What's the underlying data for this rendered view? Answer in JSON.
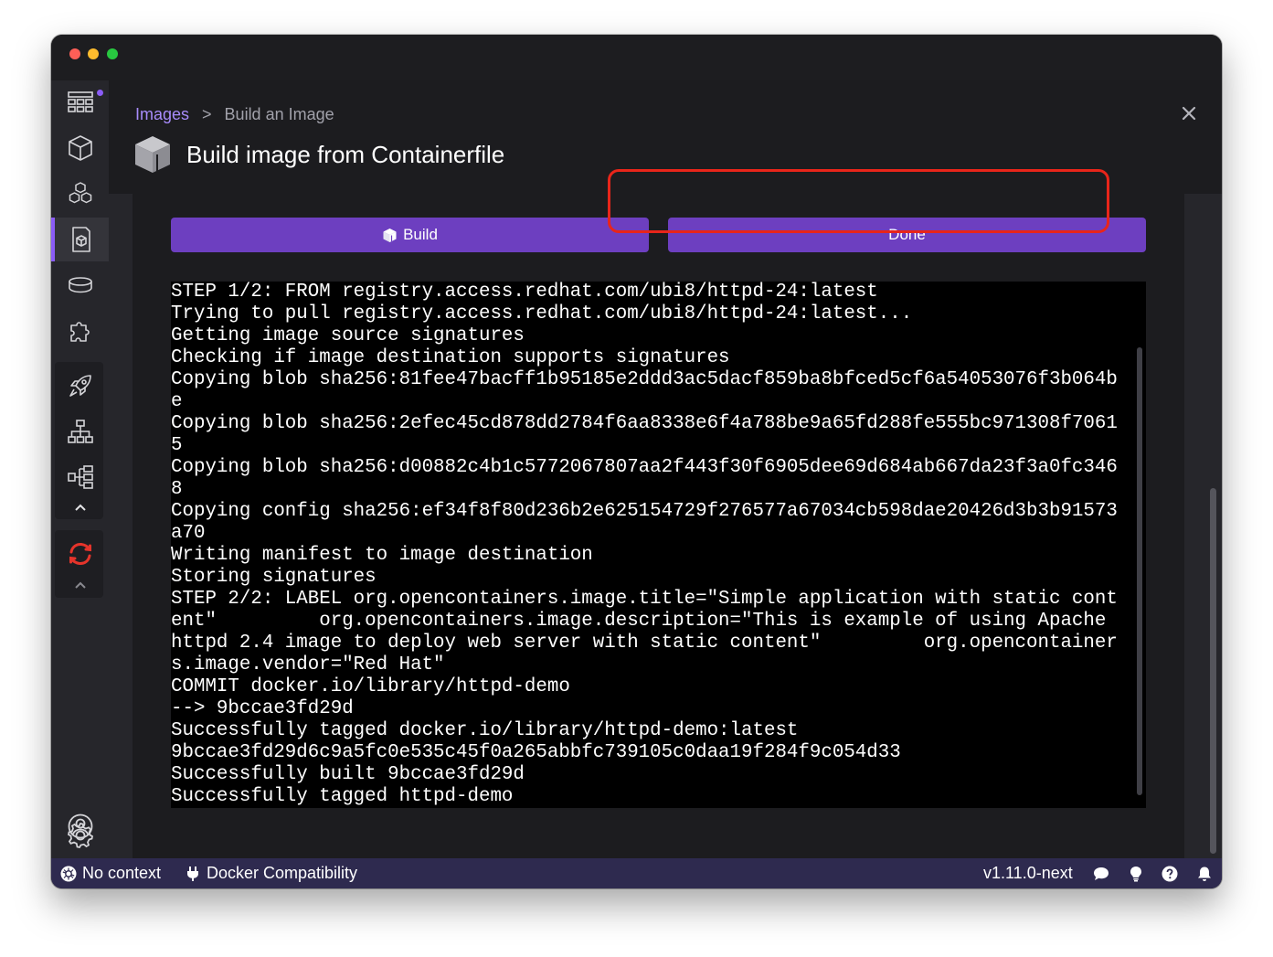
{
  "breadcrumb": {
    "parent": "Images",
    "separator": ">",
    "current": "Build an Image"
  },
  "page": {
    "title": "Build image from Containerfile"
  },
  "buttons": {
    "build": "Build",
    "done": "Done"
  },
  "terminal": {
    "lines": [
      "STEP 1/2: FROM registry.access.redhat.com/ubi8/httpd-24:latest",
      "Trying to pull registry.access.redhat.com/ubi8/httpd-24:latest...",
      "Getting image source signatures",
      "Checking if image destination supports signatures",
      "Copying blob sha256:81fee47bacff1b95185e2ddd3ac5dacf859ba8bfced5cf6a54053076f3b064b",
      "e",
      "Copying blob sha256:2efec45cd878dd2784f6aa8338e6f4a788be9a65fd288fe555bc971308f7061",
      "5",
      "Copying blob sha256:d00882c4b1c5772067807aa2f443f30f6905dee69d684ab667da23f3a0fc346",
      "8",
      "Copying config sha256:ef34f8f80d236b2e625154729f276577a67034cb598dae20426d3b3b91573",
      "a70",
      "Writing manifest to image destination",
      "Storing signatures",
      "STEP 2/2: LABEL org.opencontainers.image.title=\"Simple application with static cont",
      "ent\"         org.opencontainers.image.description=\"This is example of using Apache",
      "httpd 2.4 image to deploy web server with static content\"         org.opencontainer",
      "s.image.vendor=\"Red Hat\"",
      "COMMIT docker.io/library/httpd-demo",
      "--> 9bccae3fd29d",
      "Successfully tagged docker.io/library/httpd-demo:latest",
      "9bccae3fd29d6c9a5fc0e535c45f0a265abbfc739105c0daa19f284f9c054d33",
      "Successfully built 9bccae3fd29d",
      "Successfully tagged httpd-demo"
    ]
  },
  "statusbar": {
    "context": "No context",
    "compat": "Docker Compatibility",
    "version": "v1.11.0-next"
  },
  "colors": {
    "accent": "#6d3fc0",
    "highlight": "#e8251a",
    "statusbar": "#2e2a4f"
  }
}
